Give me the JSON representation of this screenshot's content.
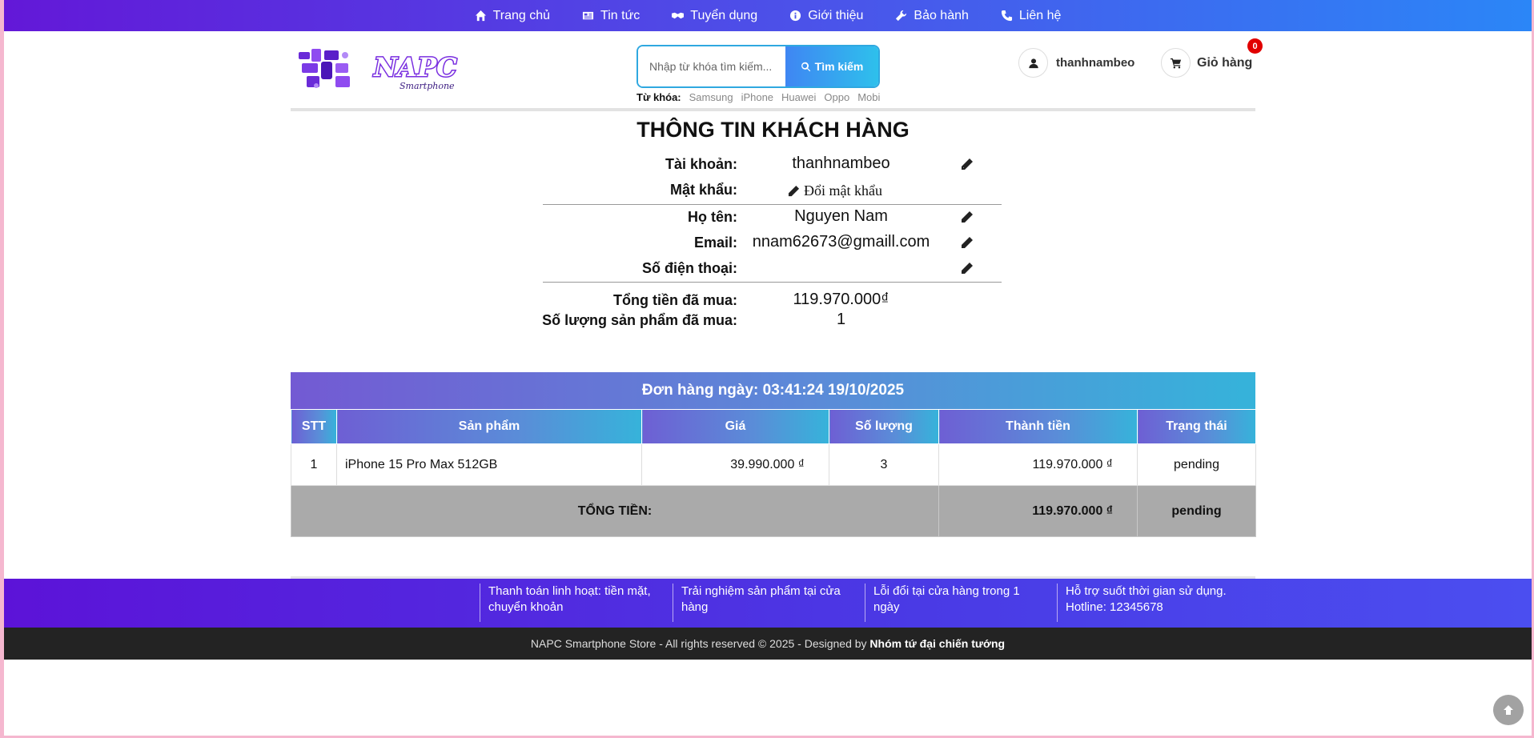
{
  "nav": {
    "items": [
      {
        "label": "Trang chủ",
        "icon": "home-icon"
      },
      {
        "label": "Tin tức",
        "icon": "newspaper-icon"
      },
      {
        "label": "Tuyển dụng",
        "icon": "handshake-icon"
      },
      {
        "label": "Giới thiệu",
        "icon": "info-icon"
      },
      {
        "label": "Bảo hành",
        "icon": "wrench-icon"
      },
      {
        "label": "Liên hệ",
        "icon": "phone-icon"
      }
    ]
  },
  "header": {
    "logo_text": "NAPC",
    "logo_sub": "Smartphone",
    "search_placeholder": "Nhập từ khóa tìm kiếm...",
    "search_button": "Tìm kiếm",
    "keywords_label": "Từ khóa:",
    "keywords": [
      "Samsung",
      "iPhone",
      "Huawei",
      "Oppo",
      "Mobi"
    ],
    "username": "thanhnambeo",
    "cart_label": "Giỏ hàng",
    "cart_count": "0"
  },
  "customer": {
    "title": "THÔNG TIN KHÁCH HÀNG",
    "account_label": "Tài khoản:",
    "account_value": "thanhnambeo",
    "password_label": "Mật khẩu:",
    "password_link": "Đổi mật khẩu",
    "name_label": "Họ tên:",
    "name_value": "Nguyen Nam",
    "email_label": "Email:",
    "email_value": "nnam62673@gmaill.com",
    "phone_label": "Số điện thoại:",
    "phone_value": "",
    "total_spent_label": "Tổng tiền đã mua:",
    "total_spent_value": "119.970.000₫",
    "items_bought_label": "Số lượng sản phẩm đã mua:",
    "items_bought_value": "1"
  },
  "order": {
    "heading": "Đơn hàng ngày: 03:41:24 19/10/2025",
    "columns": [
      "STT",
      "Sản phẩm",
      "Giá",
      "Số lượng",
      "Thành tiền",
      "Trạng thái"
    ],
    "rows": [
      {
        "stt": "1",
        "product": "iPhone 15 Pro Max 512GB",
        "price": "39.990.000 ₫",
        "qty": "3",
        "subtotal": "119.970.000 ₫",
        "status": "pending"
      }
    ],
    "total_label": "TỔNG TIỀN:",
    "total_value": "119.970.000 ₫",
    "total_status": "pending"
  },
  "footer": {
    "features": [
      "Thanh toán linh hoạt: tiền mặt, chuyển khoản",
      "Trải nghiệm sản phẩm tại cửa hàng",
      "Lỗi đổi tại cửa hàng trong 1 ngày",
      "Hỗ trợ suốt thời gian sử dụng. Hotline: 12345678"
    ],
    "copyright": "NAPC Smartphone Store - All rights reserved © 2025 - Designed by",
    "designer": "Nhóm tứ đại chiến tướng"
  }
}
